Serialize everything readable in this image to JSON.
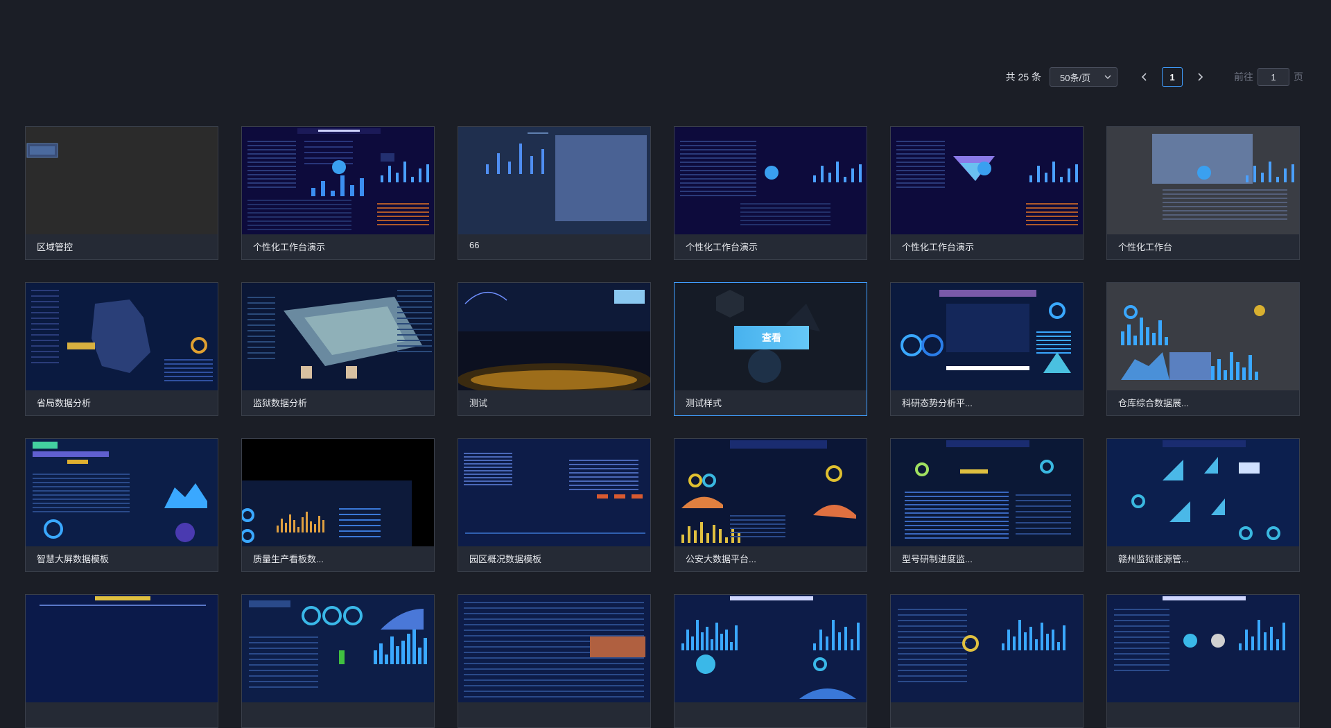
{
  "pagination": {
    "total": "共 25 条",
    "page_size": "50条/页",
    "current_page": "1",
    "goto_label": "前往",
    "goto_value": "1",
    "goto_unit": "页"
  },
  "view_label": "查看",
  "cards": [
    {
      "title": "区域管控"
    },
    {
      "title": "个性化工作台演示"
    },
    {
      "title": "66"
    },
    {
      "title": "个性化工作台演示"
    },
    {
      "title": "个性化工作台演示"
    },
    {
      "title": "个性化工作台"
    },
    {
      "title": "省局数据分析"
    },
    {
      "title": "监狱数据分析"
    },
    {
      "title": "测试"
    },
    {
      "title": "测试样式"
    },
    {
      "title": "科研态势分析平..."
    },
    {
      "title": "仓库综合数据展..."
    },
    {
      "title": "智慧大屏数据模板"
    },
    {
      "title": "质量生产看板数..."
    },
    {
      "title": "园区概况数据模板"
    },
    {
      "title": "公安大数据平台..."
    },
    {
      "title": "型号研制进度监..."
    },
    {
      "title": "赣州监狱能源管..."
    },
    {
      "title": ""
    },
    {
      "title": ""
    },
    {
      "title": ""
    },
    {
      "title": ""
    },
    {
      "title": ""
    },
    {
      "title": ""
    }
  ],
  "colors": {
    "accent": "#409eff",
    "page_bg": "#1b1e26",
    "card_bg": "#252a35",
    "view_button": "#55bcf3"
  }
}
